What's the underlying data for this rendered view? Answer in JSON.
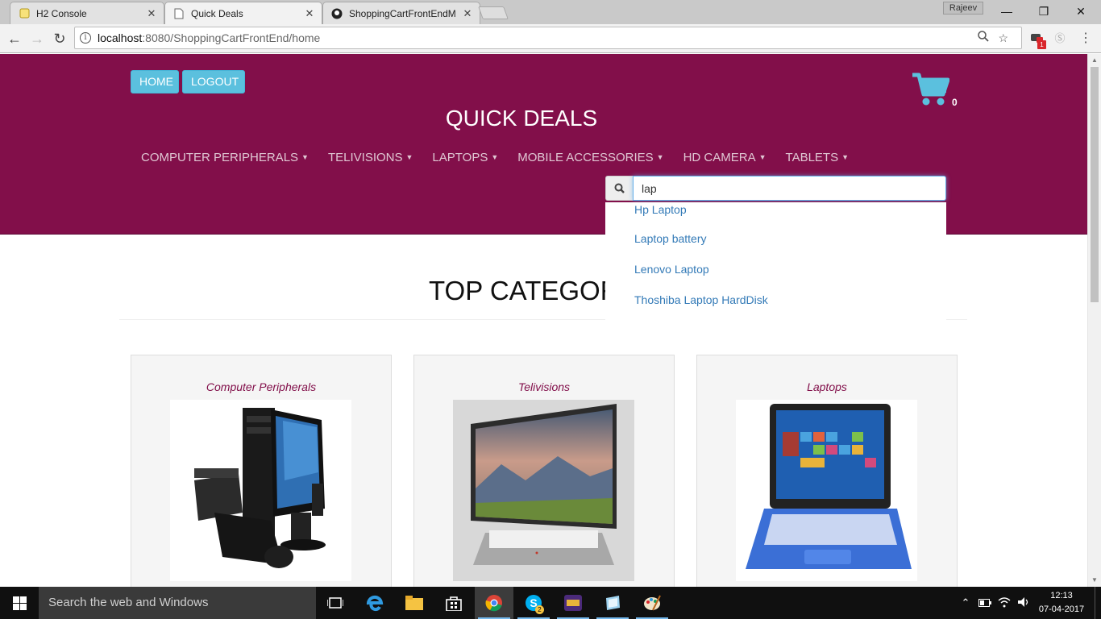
{
  "browser": {
    "tabs": [
      {
        "title": "H2 Console",
        "icon": "h2-icon"
      },
      {
        "title": "Quick Deals",
        "icon": "page-icon",
        "active": true
      },
      {
        "title": "ShoppingCartFrontEndM",
        "icon": "github-icon"
      }
    ],
    "profile_name": "Rajeev",
    "url_host": "localhost",
    "url_rest": ":8080/ShoppingCartFrontEnd/home",
    "extension_badge": "1"
  },
  "header": {
    "home_label": "HOME",
    "logout_label": "LOGOUT",
    "brand": "QUICK DEALS",
    "cart_count": "0",
    "menu": [
      "COMPUTER PERIPHERALS",
      "TELIVISIONS",
      "LAPTOPS",
      "MOBILE ACCESSORIES",
      "HD CAMERA",
      "TABLETS"
    ]
  },
  "search": {
    "value": "lap",
    "suggestions": [
      "Hp Laptop",
      "Laptop battery",
      "Lenovo Laptop",
      "Thoshiba Laptop HardDisk"
    ]
  },
  "main": {
    "section_title": "TOP CATEGORIES",
    "cards": [
      {
        "title": "Computer Peripherals"
      },
      {
        "title": "Telivisions"
      },
      {
        "title": "Laptops"
      }
    ]
  },
  "taskbar": {
    "search_placeholder": "Search the web and Windows",
    "skype_badge": "2",
    "time": "12:13",
    "date": "07-04-2017"
  },
  "colors": {
    "header_bg": "#820f4a",
    "button_bg": "#5bc0de",
    "link": "#337ab7"
  }
}
